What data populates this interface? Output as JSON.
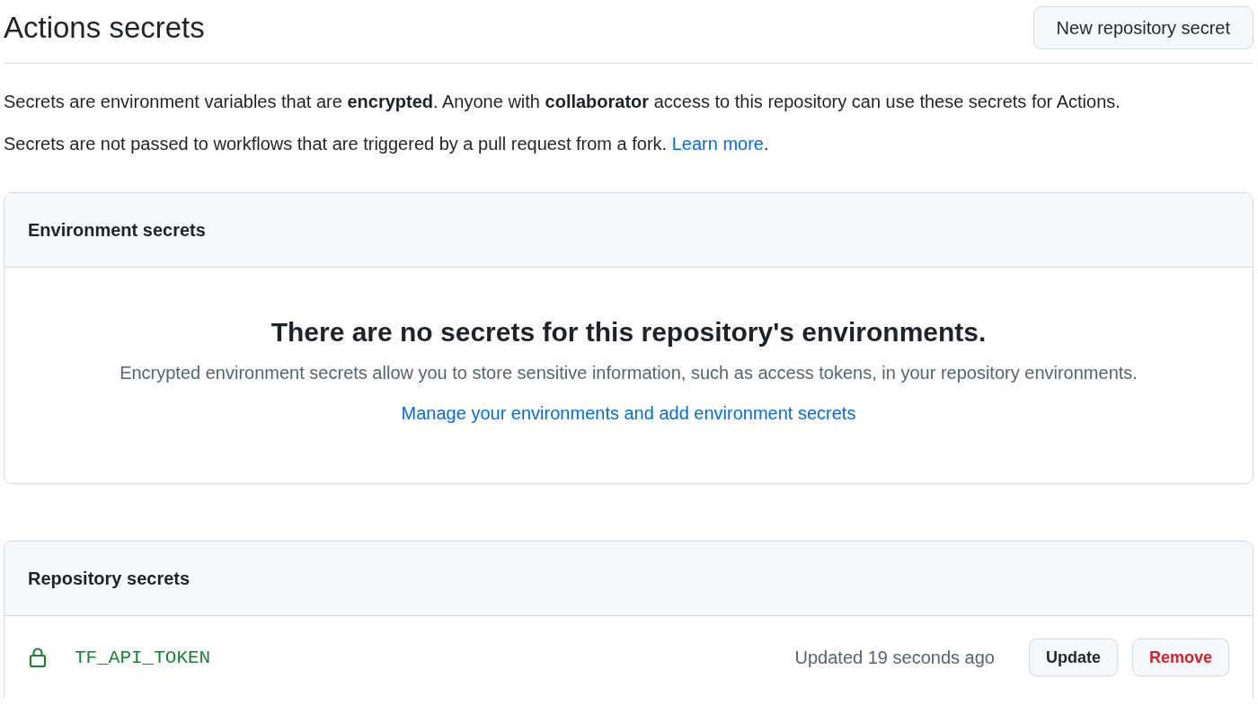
{
  "header": {
    "title": "Actions secrets",
    "button": "New repository secret"
  },
  "intro": [
    {
      "text": "Secrets are environment variables that are **encrypted**. Anyone with **collaborator** access to this repository can use these secrets for Actions."
    },
    {
      "text": "Secrets are not passed to workflows that are triggered by a pull request from a fork.",
      "link": "Learn more",
      "after": "."
    }
  ],
  "environment_secrets": {
    "heading": "Environment secrets",
    "empty_title": "There are no secrets for this repository's environments.",
    "empty_description": "Encrypted environment secrets allow you to store sensitive information, such as access tokens, in your repository environments.",
    "link": "Manage your environments and add environment secrets"
  },
  "repository_secrets": {
    "heading": "Repository secrets",
    "secrets": [
      {
        "name": "TF_API_TOKEN",
        "updated": "Updated 19 seconds ago",
        "buttons": [
          {
            "label": "Update",
            "kind": "default"
          },
          {
            "label": "Remove",
            "kind": "danger"
          }
        ]
      }
    ]
  }
}
